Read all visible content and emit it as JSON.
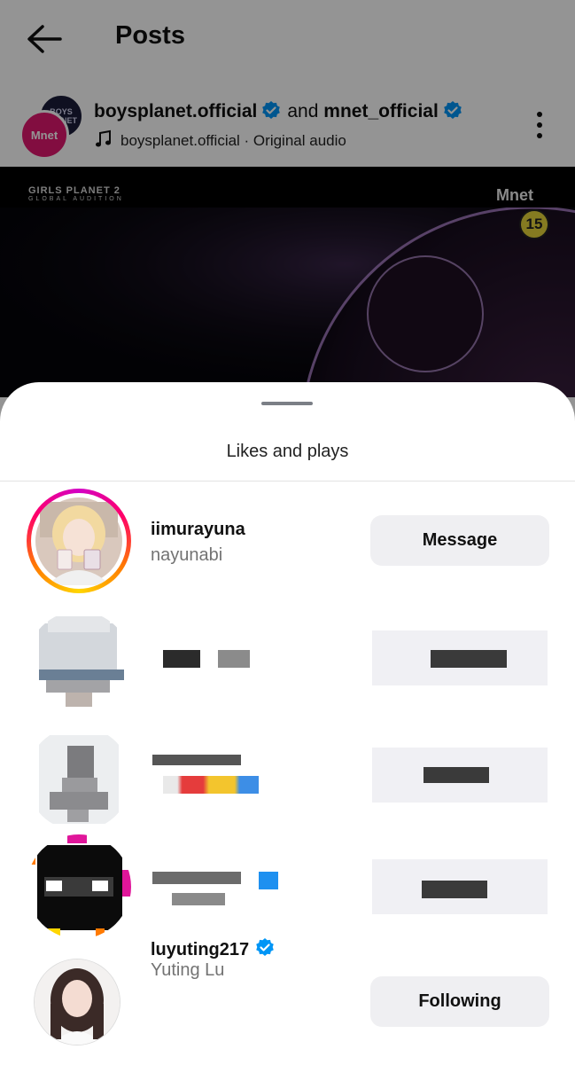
{
  "header": {
    "title": "Posts"
  },
  "post": {
    "author_primary": "boysplanet.official",
    "joiner": "and",
    "author_secondary": "mnet_official",
    "audio_label": "boysplanet.official · Original audio",
    "avatar_back_text": "BOYS PLANET",
    "avatar_front_text": "Mnet",
    "video": {
      "show_logo": "GIRLS PLANET 2",
      "show_logo_sub": "GLOBAL AUDITION",
      "channel_logo": "Mnet",
      "age_rating": "15"
    }
  },
  "sheet": {
    "title": "Likes and plays",
    "users": [
      {
        "username": "iimurayuna",
        "full_name": "nayunabi",
        "button": "Message",
        "verified": false,
        "story_ring": true,
        "redacted": false
      },
      {
        "redacted": true
      },
      {
        "redacted": true
      },
      {
        "redacted": true
      },
      {
        "username": "luyuting217",
        "full_name": "Yuting Lu",
        "button": "Following",
        "verified": true,
        "story_ring": false,
        "redacted": false
      }
    ]
  },
  "colors": {
    "verified_blue": "#0095f6",
    "button_bg": "#efeff2",
    "secondary_text": "#737373",
    "mnet_pink": "#e0176f"
  }
}
